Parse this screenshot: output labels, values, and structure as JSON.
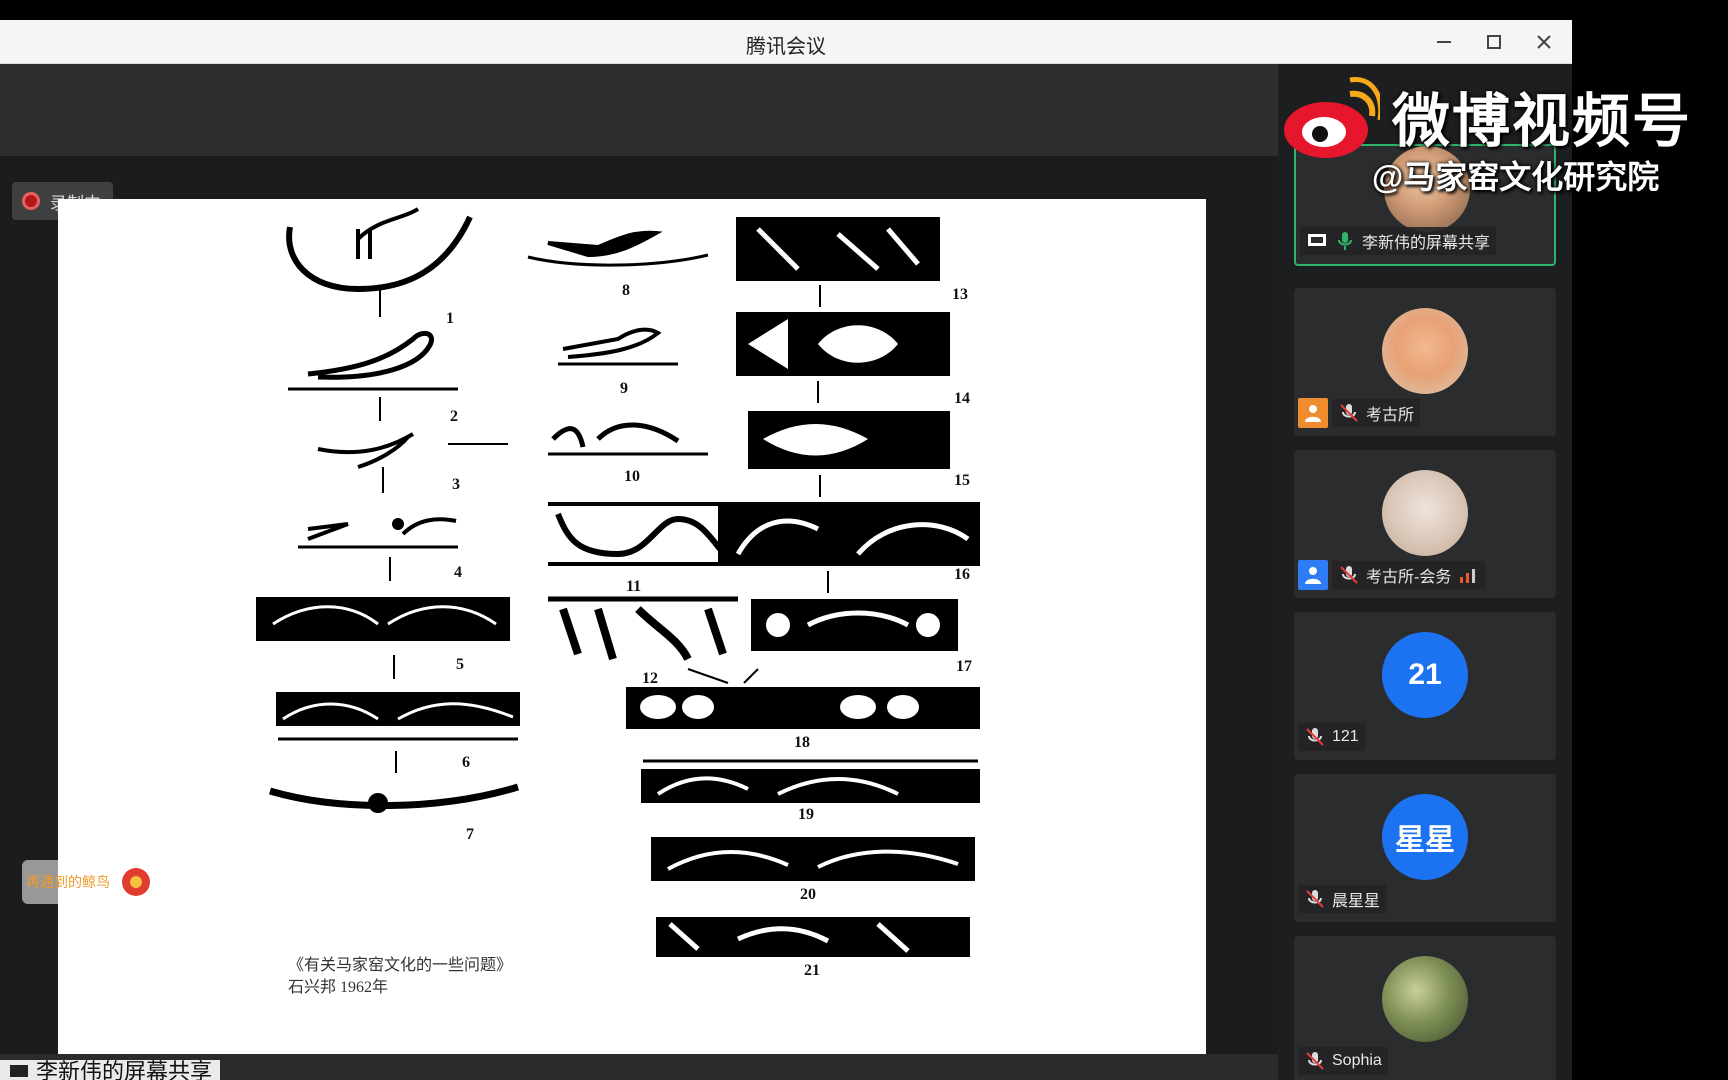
{
  "window": {
    "title": "腾讯会议"
  },
  "recording": {
    "label": "录制中"
  },
  "floating_badge": {
    "label": "再遇到的鲸鸟"
  },
  "slide": {
    "caption_line1": "《有关马家窑文化的一些问题》",
    "caption_line2": "石兴邦 1962年",
    "figure_numbers": [
      "1",
      "2",
      "3",
      "4",
      "5",
      "6",
      "7",
      "8",
      "9",
      "10",
      "11",
      "12",
      "13",
      "14",
      "15",
      "16",
      "17",
      "18",
      "19",
      "20",
      "21"
    ]
  },
  "bottom": {
    "share_label": "李新伟的屏幕共享"
  },
  "watermark": {
    "title": "微博视频号",
    "subtitle": "@马家窑文化研究院"
  },
  "participants": [
    {
      "name": "李新伟的屏幕共享",
      "avatar_text": "",
      "kind": "photo1",
      "active": true,
      "badge": "share"
    },
    {
      "name": "考古所",
      "avatar_text": "",
      "kind": "photo2",
      "active": false,
      "badge": "orange"
    },
    {
      "name": "考古所-会务",
      "avatar_text": "",
      "kind": "photo3",
      "active": false,
      "badge": "blue"
    },
    {
      "name": "121",
      "avatar_text": "21",
      "kind": "blue",
      "active": false,
      "badge": "none"
    },
    {
      "name": "晨星星",
      "avatar_text": "星星",
      "kind": "blue",
      "active": false,
      "badge": "none"
    },
    {
      "name": "Sophia",
      "avatar_text": "",
      "kind": "photo4",
      "active": false,
      "badge": "none"
    }
  ],
  "colors": {
    "accent_blue": "#1c73f2",
    "active_border": "#2fb36a",
    "record_red": "#b3171a"
  }
}
